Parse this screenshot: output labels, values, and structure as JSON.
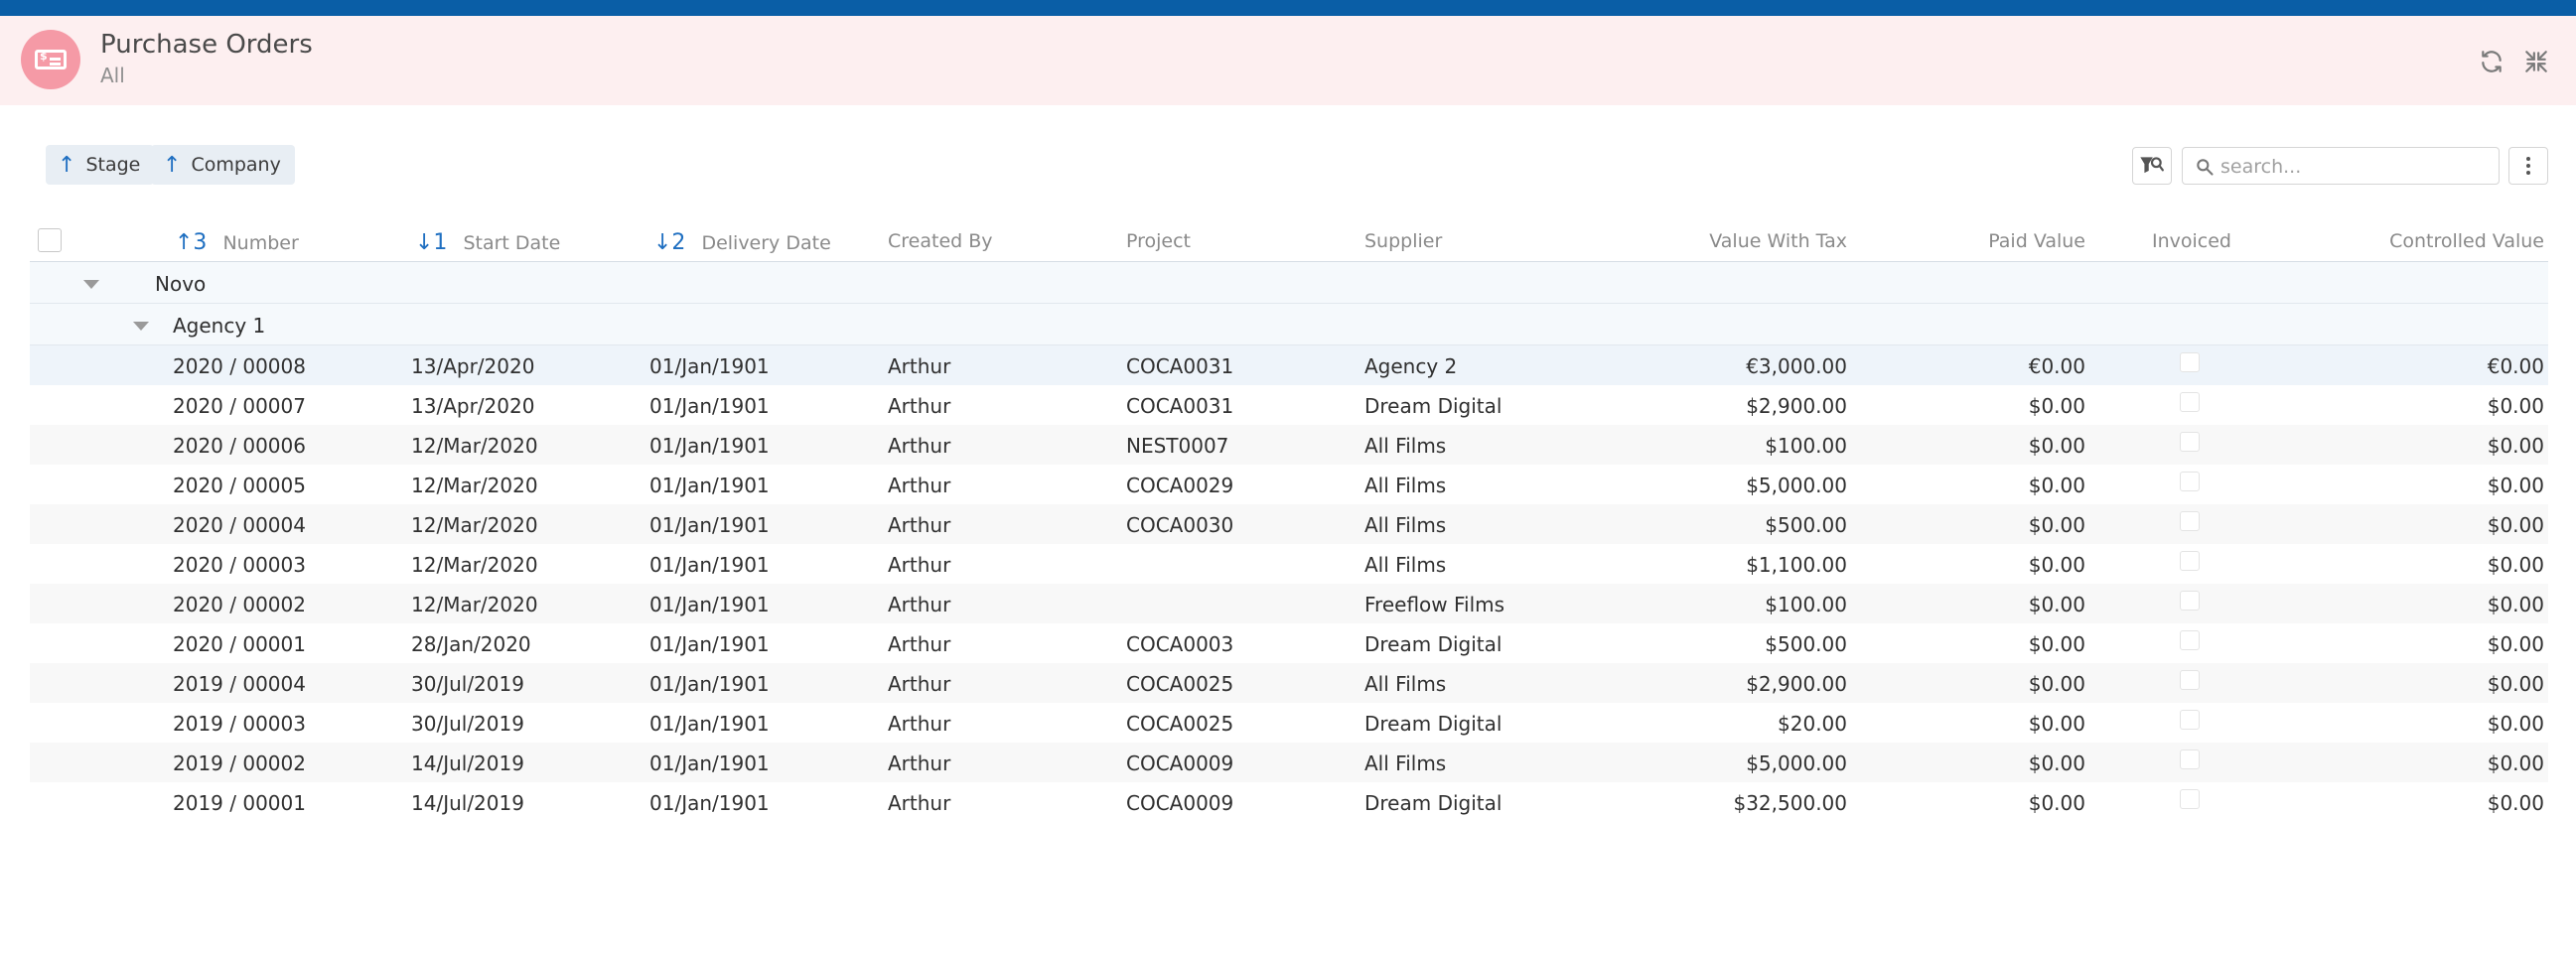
{
  "header": {
    "title": "Purchase Orders",
    "subtitle": "All"
  },
  "sort_chips": [
    {
      "label": "Stage"
    },
    {
      "label": "Company"
    }
  ],
  "search": {
    "placeholder": "search...",
    "value": ""
  },
  "columns": {
    "number": {
      "label": "Number",
      "sort": "↑3"
    },
    "start_date": {
      "label": "Start Date",
      "sort": "↓1"
    },
    "delivery_date": {
      "label": "Delivery Date",
      "sort": "↓2"
    },
    "created_by": {
      "label": "Created By"
    },
    "project": {
      "label": "Project"
    },
    "supplier": {
      "label": "Supplier"
    },
    "value_with_tax": {
      "label": "Value With Tax"
    },
    "paid_value": {
      "label": "Paid Value"
    },
    "invoiced": {
      "label": "Invoiced"
    },
    "controlled_value": {
      "label": "Controlled Value"
    }
  },
  "groups": {
    "stage": "Novo",
    "company": "Agency 1"
  },
  "rows": [
    {
      "number": "2020 / 00008",
      "start": "13/Apr/2020",
      "delivery": "01/Jan/1901",
      "created_by": "Arthur",
      "project": "COCA0031",
      "supplier": "Agency 2",
      "value": "€3,000.00",
      "paid": "€0.00",
      "controlled": "€0.00"
    },
    {
      "number": "2020 / 00007",
      "start": "13/Apr/2020",
      "delivery": "01/Jan/1901",
      "created_by": "Arthur",
      "project": "COCA0031",
      "supplier": "Dream Digital",
      "value": "$2,900.00",
      "paid": "$0.00",
      "controlled": "$0.00"
    },
    {
      "number": "2020 / 00006",
      "start": "12/Mar/2020",
      "delivery": "01/Jan/1901",
      "created_by": "Arthur",
      "project": "NEST0007",
      "supplier": "All Films",
      "value": "$100.00",
      "paid": "$0.00",
      "controlled": "$0.00"
    },
    {
      "number": "2020 / 00005",
      "start": "12/Mar/2020",
      "delivery": "01/Jan/1901",
      "created_by": "Arthur",
      "project": "COCA0029",
      "supplier": "All Films",
      "value": "$5,000.00",
      "paid": "$0.00",
      "controlled": "$0.00"
    },
    {
      "number": "2020 / 00004",
      "start": "12/Mar/2020",
      "delivery": "01/Jan/1901",
      "created_by": "Arthur",
      "project": "COCA0030",
      "supplier": "All Films",
      "value": "$500.00",
      "paid": "$0.00",
      "controlled": "$0.00"
    },
    {
      "number": "2020 / 00003",
      "start": "12/Mar/2020",
      "delivery": "01/Jan/1901",
      "created_by": "Arthur",
      "project": "",
      "supplier": "All Films",
      "value": "$1,100.00",
      "paid": "$0.00",
      "controlled": "$0.00"
    },
    {
      "number": "2020 / 00002",
      "start": "12/Mar/2020",
      "delivery": "01/Jan/1901",
      "created_by": "Arthur",
      "project": "",
      "supplier": "Freeflow Films",
      "value": "$100.00",
      "paid": "$0.00",
      "controlled": "$0.00"
    },
    {
      "number": "2020 / 00001",
      "start": "28/Jan/2020",
      "delivery": "01/Jan/1901",
      "created_by": "Arthur",
      "project": "COCA0003",
      "supplier": "Dream Digital",
      "value": "$500.00",
      "paid": "$0.00",
      "controlled": "$0.00"
    },
    {
      "number": "2019 / 00004",
      "start": "30/Jul/2019",
      "delivery": "01/Jan/1901",
      "created_by": "Arthur",
      "project": "COCA0025",
      "supplier": "All Films",
      "value": "$2,900.00",
      "paid": "$0.00",
      "controlled": "$0.00"
    },
    {
      "number": "2019 / 00003",
      "start": "30/Jul/2019",
      "delivery": "01/Jan/1901",
      "created_by": "Arthur",
      "project": "COCA0025",
      "supplier": "Dream Digital",
      "value": "$20.00",
      "paid": "$0.00",
      "controlled": "$0.00"
    },
    {
      "number": "2019 / 00002",
      "start": "14/Jul/2019",
      "delivery": "01/Jan/1901",
      "created_by": "Arthur",
      "project": "COCA0009",
      "supplier": "All Films",
      "value": "$5,000.00",
      "paid": "$0.00",
      "controlled": "$0.00"
    },
    {
      "number": "2019 / 00001",
      "start": "14/Jul/2019",
      "delivery": "01/Jan/1901",
      "created_by": "Arthur",
      "project": "COCA0009",
      "supplier": "Dream Digital",
      "value": "$32,500.00",
      "paid": "$0.00",
      "controlled": "$0.00"
    }
  ],
  "colors": {
    "topbar": "#0a5ea6",
    "header_bg": "#fdeff0",
    "app_icon": "#f59aa6",
    "accent": "#1f6fc1"
  },
  "icons": {
    "app": "purchase-card-icon",
    "refresh": "refresh-icon",
    "collapse": "collapse-icon",
    "group_filter": "group-filter-icon",
    "search": "search-icon",
    "more": "more-vertical-icon"
  }
}
